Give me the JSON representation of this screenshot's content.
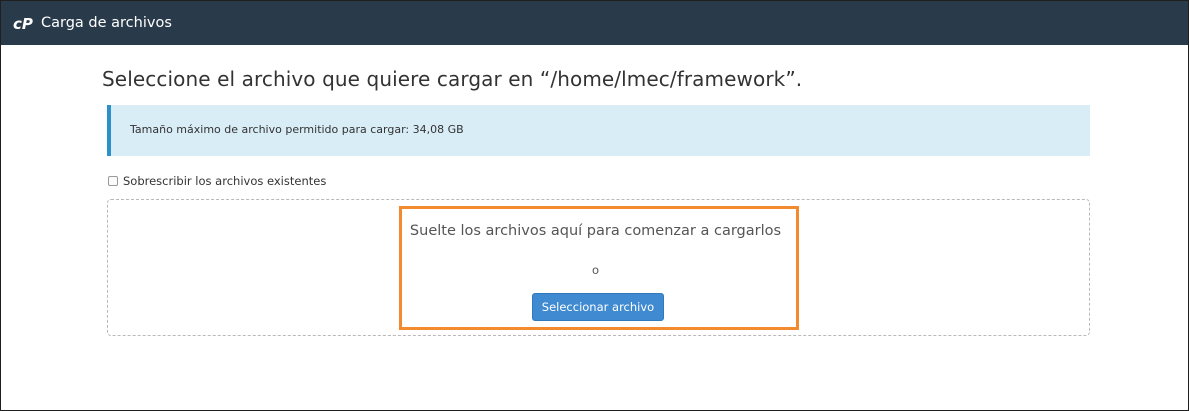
{
  "header": {
    "app_title": "Carga de archivos",
    "logo_icon": "cpanel-logo-icon",
    "background_color": "#293a4a"
  },
  "main": {
    "title": "Seleccione el archivo que quiere cargar en “/home/lmec/framework”.",
    "info_message": "Tamaño máximo de archivo permitido para cargar: 34,08 GB",
    "overwrite_checkbox": {
      "label": "Sobrescribir los archivos existentes",
      "checked": false
    },
    "dropzone": {
      "text": "Suelte los archivos aquí para comenzar a cargarlos",
      "or_text": "o",
      "button_label": "Seleccionar archivo"
    }
  },
  "colors": {
    "info_background": "#d9edf7",
    "info_border": "#2e90c9",
    "button": "#3f8ad0",
    "highlight": "#f28b30"
  }
}
